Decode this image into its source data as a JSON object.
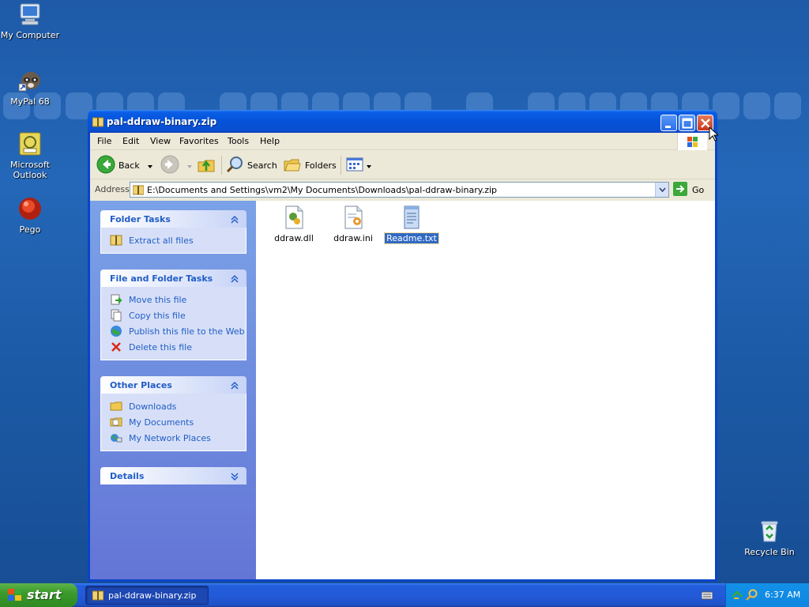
{
  "desktop": {
    "icons": [
      {
        "label": "My Computer",
        "icon": "my-computer-icon"
      },
      {
        "label": "MyPal 68",
        "icon": "mypal-icon"
      },
      {
        "label_line1": "Microsoft",
        "label_line2": "Outlook",
        "icon": "outlook-icon"
      },
      {
        "label": "Pego",
        "icon": "pego-icon"
      },
      {
        "label": "Recycle Bin",
        "icon": "recycle-bin-icon"
      }
    ]
  },
  "window": {
    "title": "pal-ddraw-binary.zip",
    "menu": [
      "File",
      "Edit",
      "View",
      "Favorites",
      "Tools",
      "Help"
    ],
    "toolbar": {
      "back": "Back",
      "search": "Search",
      "folders": "Folders"
    },
    "address": {
      "label": "Address",
      "value": "E:\\Documents and Settings\\vm2\\My Documents\\Downloads\\pal-ddraw-binary.zip",
      "go": "Go"
    },
    "panel": {
      "folder_tasks": {
        "title": "Folder Tasks",
        "items": [
          "Extract all files"
        ]
      },
      "file_folder_tasks": {
        "title": "File and Folder Tasks",
        "items": [
          "Move this file",
          "Copy this file",
          "Publish this file to the Web",
          "Delete this file"
        ]
      },
      "other_places": {
        "title": "Other Places",
        "items": [
          "Downloads",
          "My Documents",
          "My Network Places"
        ]
      },
      "details": {
        "title": "Details"
      }
    },
    "files": [
      {
        "name": "ddraw.dll",
        "icon": "dll-file-icon"
      },
      {
        "name": "ddraw.ini",
        "icon": "ini-file-icon"
      },
      {
        "name": "Readme.txt",
        "icon": "text-file-icon",
        "selected": true
      }
    ]
  },
  "taskbar": {
    "start": "start",
    "task_button": "pal-ddraw-binary.zip",
    "clock": "6:37 AM"
  },
  "colors": {
    "desktop": "#1e5aa8",
    "titlebar": "#0453d8",
    "taskpane_link": "#215dc6",
    "start_green": "#3c9a2c",
    "selection": "#316ac5"
  }
}
